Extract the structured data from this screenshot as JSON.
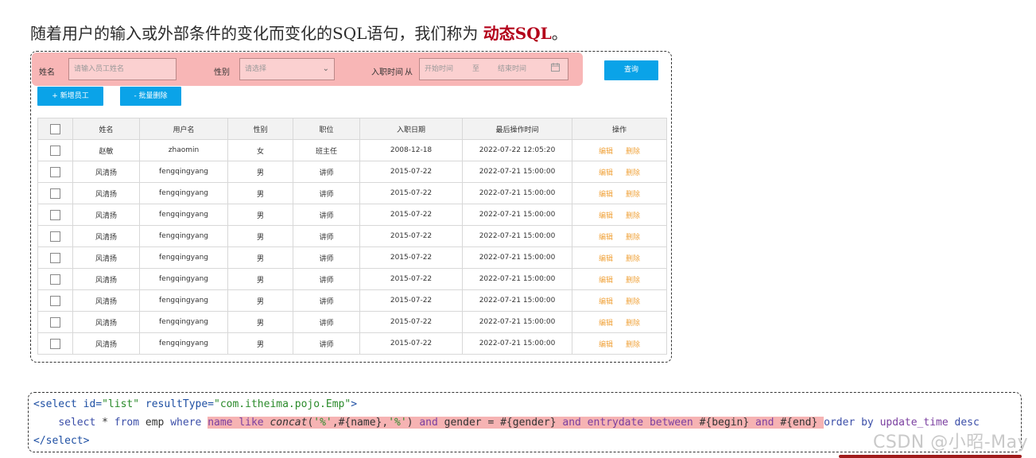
{
  "intro": {
    "text": "随着用户的输入或外部条件的变化而变化的SQL语句，我们称为 ",
    "keyword": "动态SQL",
    "period": "。"
  },
  "search_form": {
    "name_label": "姓名",
    "name_placeholder": "请输入员工姓名",
    "gender_label": "性别",
    "gender_placeholder": "请选择",
    "entry_label": "入职时间",
    "entry_from": "从",
    "start_placeholder": "开始时间",
    "range_sep": "至",
    "end_placeholder": "结束时间",
    "query_button": "查询"
  },
  "actions": {
    "add_button": "+ 新增员工",
    "batch_delete_button": "- 批量删除"
  },
  "table": {
    "columns": [
      "",
      "姓名",
      "用户名",
      "性别",
      "职位",
      "入职日期",
      "最后操作时间",
      "操作"
    ],
    "edit_label": "编辑",
    "delete_label": "删除",
    "rows": [
      {
        "name": "赵敏",
        "username": "zhaomin",
        "gender": "女",
        "position": "班主任",
        "entry_date": "2008-12-18",
        "updated": "2022-07-22 12:05:20"
      },
      {
        "name": "风清扬",
        "username": "fengqingyang",
        "gender": "男",
        "position": "讲师",
        "entry_date": "2015-07-22",
        "updated": "2022-07-21 15:00:00"
      },
      {
        "name": "风清扬",
        "username": "fengqingyang",
        "gender": "男",
        "position": "讲师",
        "entry_date": "2015-07-22",
        "updated": "2022-07-21 15:00:00"
      },
      {
        "name": "风清扬",
        "username": "fengqingyang",
        "gender": "男",
        "position": "讲师",
        "entry_date": "2015-07-22",
        "updated": "2022-07-21 15:00:00"
      },
      {
        "name": "风清扬",
        "username": "fengqingyang",
        "gender": "男",
        "position": "讲师",
        "entry_date": "2015-07-22",
        "updated": "2022-07-21 15:00:00"
      },
      {
        "name": "风清扬",
        "username": "fengqingyang",
        "gender": "男",
        "position": "讲师",
        "entry_date": "2015-07-22",
        "updated": "2022-07-21 15:00:00"
      },
      {
        "name": "风清扬",
        "username": "fengqingyang",
        "gender": "男",
        "position": "讲师",
        "entry_date": "2015-07-22",
        "updated": "2022-07-21 15:00:00"
      },
      {
        "name": "风清扬",
        "username": "fengqingyang",
        "gender": "男",
        "position": "讲师",
        "entry_date": "2015-07-22",
        "updated": "2022-07-21 15:00:00"
      },
      {
        "name": "风清扬",
        "username": "fengqingyang",
        "gender": "男",
        "position": "讲师",
        "entry_date": "2015-07-22",
        "updated": "2022-07-21 15:00:00"
      },
      {
        "name": "风清扬",
        "username": "fengqingyang",
        "gender": "男",
        "position": "讲师",
        "entry_date": "2015-07-22",
        "updated": "2022-07-21 15:00:00"
      }
    ]
  },
  "code": {
    "line1_open": "<select ",
    "line1_attr1": "id=",
    "line1_val1": "\"list\"",
    "line1_attr2": " resultType=",
    "line1_val2": "\"com.itheima.pojo.Emp\"",
    "line1_close": ">",
    "line2_indent": "    ",
    "line2_select": "select",
    "line2_star": " * ",
    "line2_from": "from",
    "line2_emp": " emp ",
    "line2_where": "where",
    "line2_space": " ",
    "hl_name": "name ",
    "hl_like": "like ",
    "hl_concat": "concat",
    "hl_args1": "(",
    "hl_q1": "'%'",
    "hl_args2": ",#{name},",
    "hl_q2": "'%'",
    "hl_args3": ") ",
    "hl_and1": "and",
    "hl_gender": " gender = #{gender} ",
    "hl_and2": "and",
    "hl_entry": " entrydate ",
    "hl_between": "between",
    "hl_begin": " #{begin} ",
    "hl_and3": "and",
    "hl_end": " #{end} ",
    "line2_order": "order by",
    "line2_col": " update_time ",
    "line2_desc": "desc",
    "line3": "</select>"
  },
  "watermark": "CSDN @小昭-May",
  "colors": {
    "highlight": "#f8b6b6",
    "primary_button": "#0aa3e8",
    "op_link": "#f0a33c",
    "keyword_red": "#b3001a"
  }
}
